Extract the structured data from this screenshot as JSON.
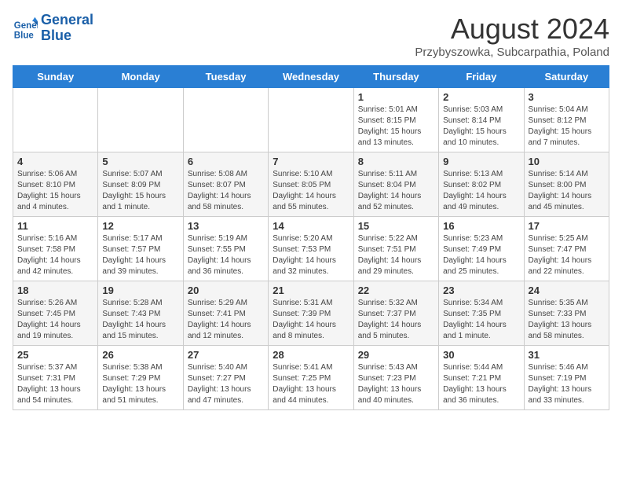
{
  "logo": {
    "line1": "General",
    "line2": "Blue"
  },
  "header": {
    "month": "August 2024",
    "location": "Przybyszowka, Subcarpathia, Poland"
  },
  "weekdays": [
    "Sunday",
    "Monday",
    "Tuesday",
    "Wednesday",
    "Thursday",
    "Friday",
    "Saturday"
  ],
  "weeks": [
    [
      {
        "day": "",
        "info": ""
      },
      {
        "day": "",
        "info": ""
      },
      {
        "day": "",
        "info": ""
      },
      {
        "day": "",
        "info": ""
      },
      {
        "day": "1",
        "info": "Sunrise: 5:01 AM\nSunset: 8:15 PM\nDaylight: 15 hours\nand 13 minutes."
      },
      {
        "day": "2",
        "info": "Sunrise: 5:03 AM\nSunset: 8:14 PM\nDaylight: 15 hours\nand 10 minutes."
      },
      {
        "day": "3",
        "info": "Sunrise: 5:04 AM\nSunset: 8:12 PM\nDaylight: 15 hours\nand 7 minutes."
      }
    ],
    [
      {
        "day": "4",
        "info": "Sunrise: 5:06 AM\nSunset: 8:10 PM\nDaylight: 15 hours\nand 4 minutes."
      },
      {
        "day": "5",
        "info": "Sunrise: 5:07 AM\nSunset: 8:09 PM\nDaylight: 15 hours\nand 1 minute."
      },
      {
        "day": "6",
        "info": "Sunrise: 5:08 AM\nSunset: 8:07 PM\nDaylight: 14 hours\nand 58 minutes."
      },
      {
        "day": "7",
        "info": "Sunrise: 5:10 AM\nSunset: 8:05 PM\nDaylight: 14 hours\nand 55 minutes."
      },
      {
        "day": "8",
        "info": "Sunrise: 5:11 AM\nSunset: 8:04 PM\nDaylight: 14 hours\nand 52 minutes."
      },
      {
        "day": "9",
        "info": "Sunrise: 5:13 AM\nSunset: 8:02 PM\nDaylight: 14 hours\nand 49 minutes."
      },
      {
        "day": "10",
        "info": "Sunrise: 5:14 AM\nSunset: 8:00 PM\nDaylight: 14 hours\nand 45 minutes."
      }
    ],
    [
      {
        "day": "11",
        "info": "Sunrise: 5:16 AM\nSunset: 7:58 PM\nDaylight: 14 hours\nand 42 minutes."
      },
      {
        "day": "12",
        "info": "Sunrise: 5:17 AM\nSunset: 7:57 PM\nDaylight: 14 hours\nand 39 minutes."
      },
      {
        "day": "13",
        "info": "Sunrise: 5:19 AM\nSunset: 7:55 PM\nDaylight: 14 hours\nand 36 minutes."
      },
      {
        "day": "14",
        "info": "Sunrise: 5:20 AM\nSunset: 7:53 PM\nDaylight: 14 hours\nand 32 minutes."
      },
      {
        "day": "15",
        "info": "Sunrise: 5:22 AM\nSunset: 7:51 PM\nDaylight: 14 hours\nand 29 minutes."
      },
      {
        "day": "16",
        "info": "Sunrise: 5:23 AM\nSunset: 7:49 PM\nDaylight: 14 hours\nand 25 minutes."
      },
      {
        "day": "17",
        "info": "Sunrise: 5:25 AM\nSunset: 7:47 PM\nDaylight: 14 hours\nand 22 minutes."
      }
    ],
    [
      {
        "day": "18",
        "info": "Sunrise: 5:26 AM\nSunset: 7:45 PM\nDaylight: 14 hours\nand 19 minutes."
      },
      {
        "day": "19",
        "info": "Sunrise: 5:28 AM\nSunset: 7:43 PM\nDaylight: 14 hours\nand 15 minutes."
      },
      {
        "day": "20",
        "info": "Sunrise: 5:29 AM\nSunset: 7:41 PM\nDaylight: 14 hours\nand 12 minutes."
      },
      {
        "day": "21",
        "info": "Sunrise: 5:31 AM\nSunset: 7:39 PM\nDaylight: 14 hours\nand 8 minutes."
      },
      {
        "day": "22",
        "info": "Sunrise: 5:32 AM\nSunset: 7:37 PM\nDaylight: 14 hours\nand 5 minutes."
      },
      {
        "day": "23",
        "info": "Sunrise: 5:34 AM\nSunset: 7:35 PM\nDaylight: 14 hours\nand 1 minute."
      },
      {
        "day": "24",
        "info": "Sunrise: 5:35 AM\nSunset: 7:33 PM\nDaylight: 13 hours\nand 58 minutes."
      }
    ],
    [
      {
        "day": "25",
        "info": "Sunrise: 5:37 AM\nSunset: 7:31 PM\nDaylight: 13 hours\nand 54 minutes."
      },
      {
        "day": "26",
        "info": "Sunrise: 5:38 AM\nSunset: 7:29 PM\nDaylight: 13 hours\nand 51 minutes."
      },
      {
        "day": "27",
        "info": "Sunrise: 5:40 AM\nSunset: 7:27 PM\nDaylight: 13 hours\nand 47 minutes."
      },
      {
        "day": "28",
        "info": "Sunrise: 5:41 AM\nSunset: 7:25 PM\nDaylight: 13 hours\nand 44 minutes."
      },
      {
        "day": "29",
        "info": "Sunrise: 5:43 AM\nSunset: 7:23 PM\nDaylight: 13 hours\nand 40 minutes."
      },
      {
        "day": "30",
        "info": "Sunrise: 5:44 AM\nSunset: 7:21 PM\nDaylight: 13 hours\nand 36 minutes."
      },
      {
        "day": "31",
        "info": "Sunrise: 5:46 AM\nSunset: 7:19 PM\nDaylight: 13 hours\nand 33 minutes."
      }
    ]
  ]
}
